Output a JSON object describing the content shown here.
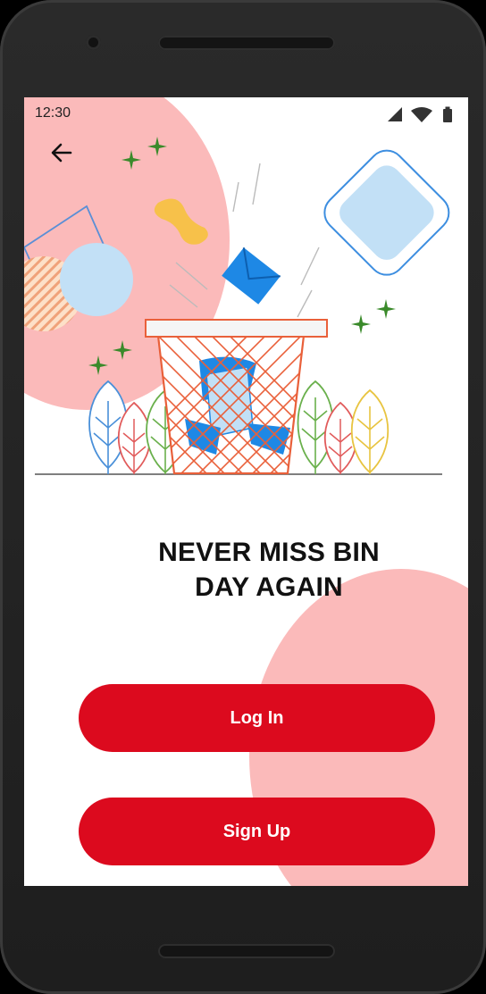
{
  "status_bar": {
    "time": "12:30"
  },
  "onboarding": {
    "headline": "NEVER MISS BIN DAY AGAIN",
    "login_label": "Log In",
    "signup_label": "Sign Up"
  },
  "colors": {
    "primary": "#dc0a1e",
    "blob": "#fbbaba",
    "illustration_blue": "#1e88e5",
    "basket_orange": "#e9603a"
  },
  "icons": {
    "back": "arrow-left-icon",
    "signal": "signal-icon",
    "wifi": "wifi-icon",
    "battery": "battery-icon"
  }
}
